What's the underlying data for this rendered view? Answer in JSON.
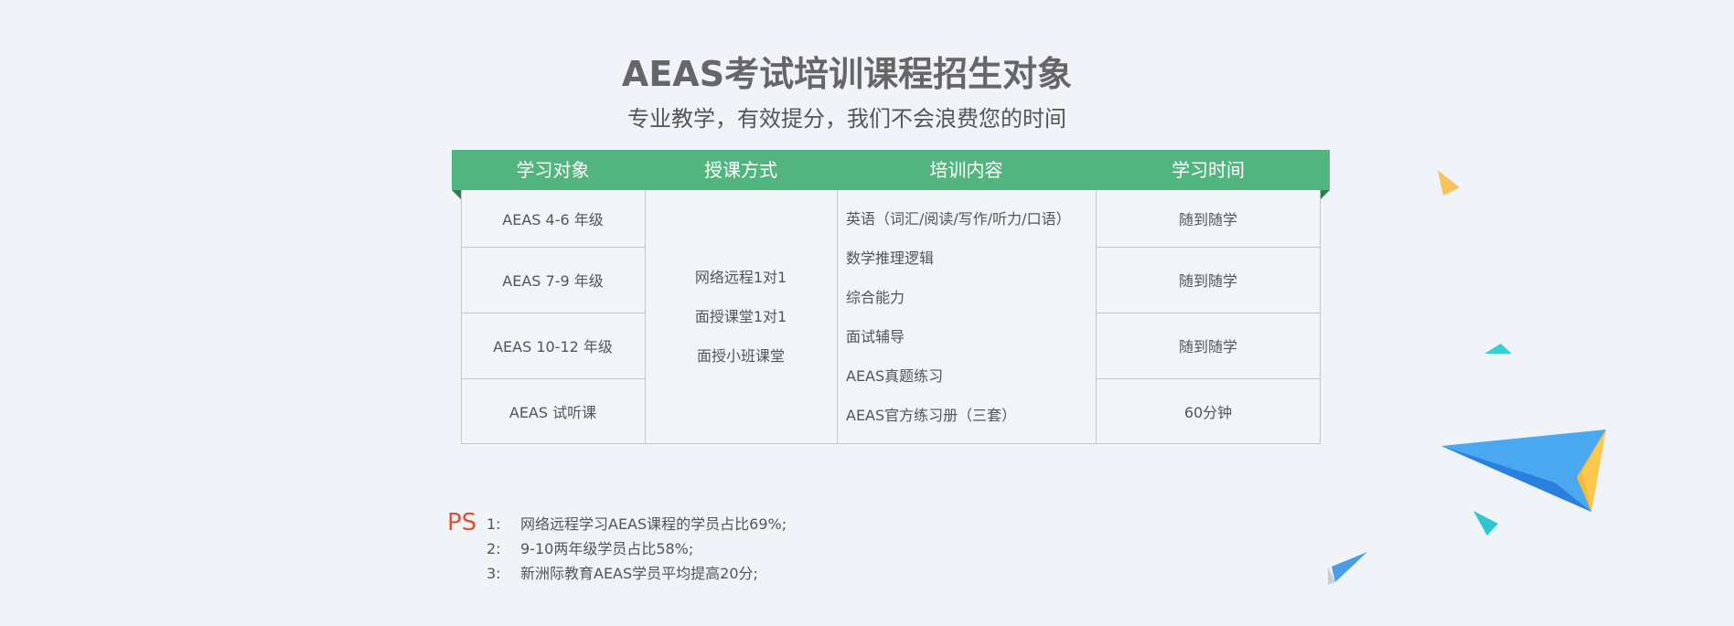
{
  "header": {
    "title": "AEAS考试培训课程招生对象",
    "subtitle": "专业教学，有效提分，我们不会浪费您的时间"
  },
  "table": {
    "columns": [
      "学习对象",
      "授课方式",
      "培训内容",
      "学习时间"
    ],
    "targets": [
      "AEAS 4-6 年级",
      "AEAS 7-9 年级",
      "AEAS 10-12 年级",
      "AEAS 试听课"
    ],
    "methods": [
      "网络远程1对1",
      "面授课堂1对1",
      "面授小班课堂"
    ],
    "contents": [
      "英语（词汇/阅读/写作/听力/口语）",
      "数学推理逻辑",
      "综合能力",
      "面试辅导",
      "AEAS真题练习",
      "AEAS官方练习册（三套）"
    ],
    "times": [
      "随到随学",
      "随到随学",
      "随到随学",
      "60分钟"
    ]
  },
  "notes": {
    "label": "PS",
    "items": [
      {
        "num": "1:",
        "text": "网络远程学习AEAS课程的学员占比69%;"
      },
      {
        "num": "2:",
        "text": "9-10两年级学员占比58%;"
      },
      {
        "num": "3:",
        "text": "新洲际教育AEAS学员平均提高20分;"
      }
    ]
  },
  "colors": {
    "header_green": "#52b57f",
    "ps_red": "#e0502a",
    "background": "#f0f4f8"
  }
}
